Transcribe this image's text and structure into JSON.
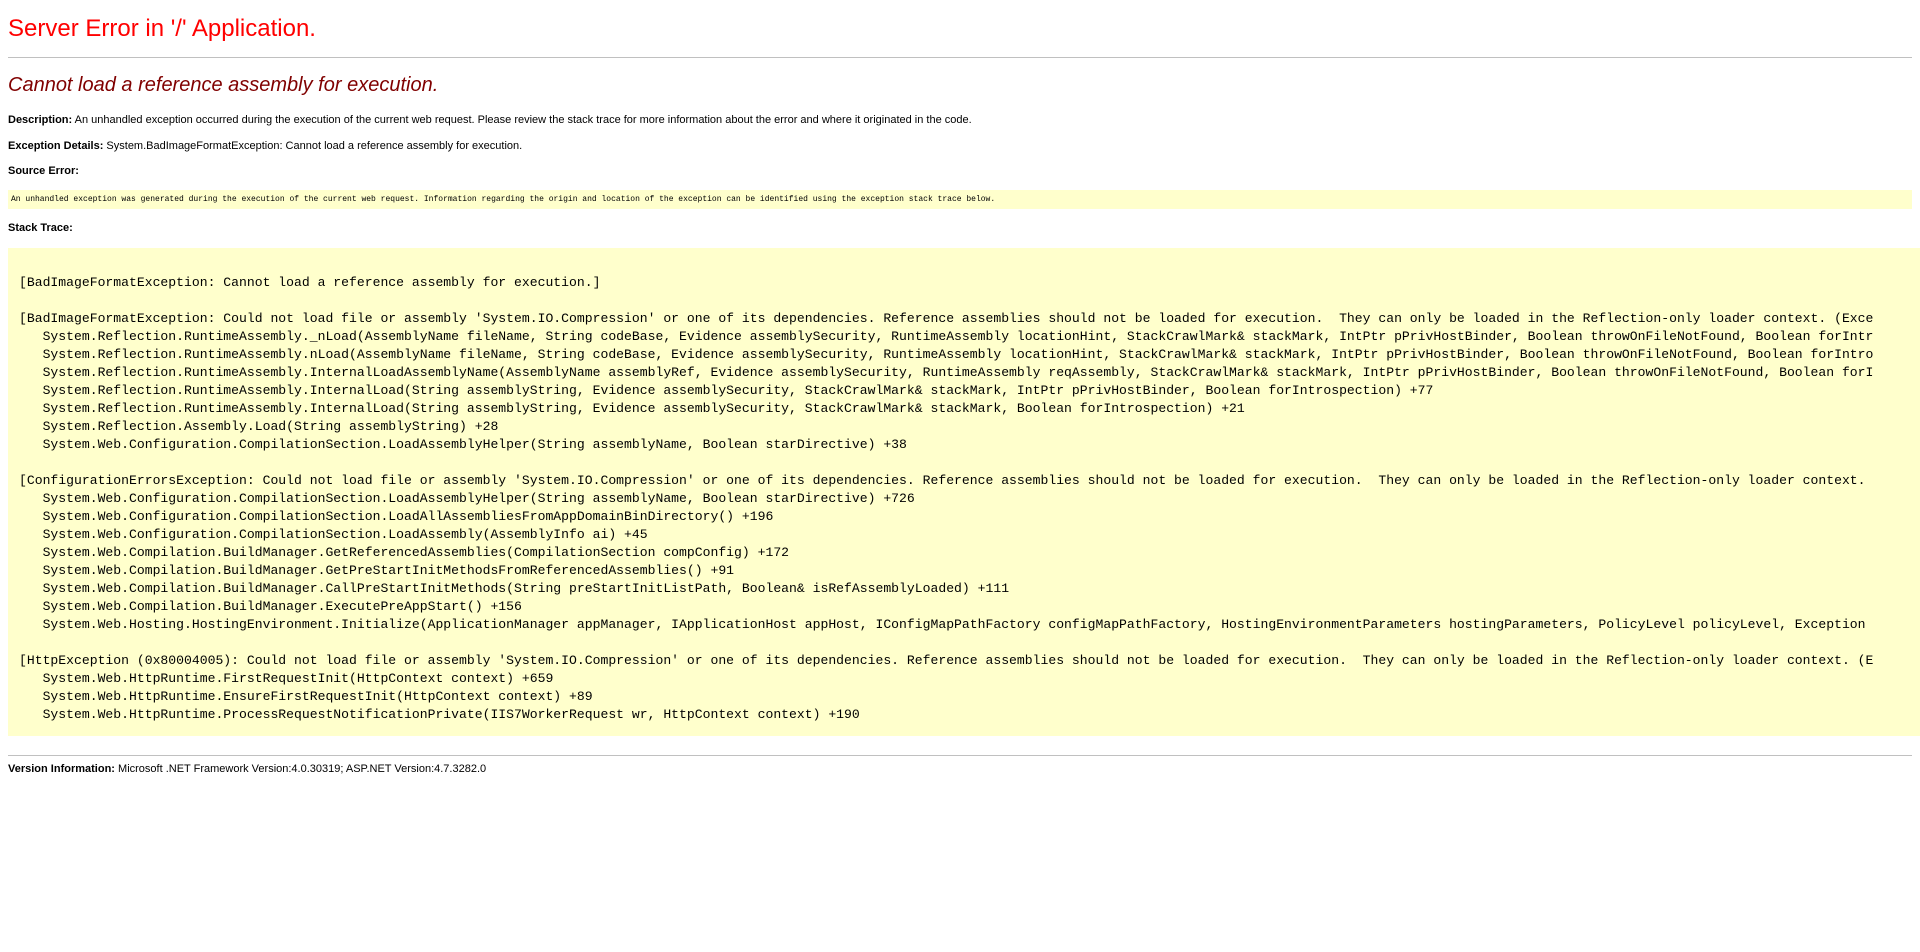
{
  "header": {
    "title": "Server Error in '/' Application."
  },
  "error": {
    "message": "Cannot load a reference assembly for execution."
  },
  "description": {
    "label": "Description:",
    "text": "An unhandled exception occurred during the execution of the current web request. Please review the stack trace for more information about the error and where it originated in the code."
  },
  "exception_details": {
    "label": "Exception Details:",
    "text": "System.BadImageFormatException: Cannot load a reference assembly for execution."
  },
  "source_error": {
    "label": "Source Error:",
    "text": "An unhandled exception was generated during the execution of the current web request. Information regarding the origin and location of the exception can be identified using the exception stack trace below."
  },
  "stack_trace": {
    "label": "Stack Trace:",
    "lines": [
      "",
      "[BadImageFormatException: Cannot load a reference assembly for execution.]",
      "",
      "[BadImageFormatException: Could not load file or assembly 'System.IO.Compression' or one of its dependencies. Reference assemblies should not be loaded for execution.  They can only be loaded in the Reflection-only loader context. (Exce",
      "   System.Reflection.RuntimeAssembly._nLoad(AssemblyName fileName, String codeBase, Evidence assemblySecurity, RuntimeAssembly locationHint, StackCrawlMark& stackMark, IntPtr pPrivHostBinder, Boolean throwOnFileNotFound, Boolean forIntr",
      "   System.Reflection.RuntimeAssembly.nLoad(AssemblyName fileName, String codeBase, Evidence assemblySecurity, RuntimeAssembly locationHint, StackCrawlMark& stackMark, IntPtr pPrivHostBinder, Boolean throwOnFileNotFound, Boolean forIntro",
      "   System.Reflection.RuntimeAssembly.InternalLoadAssemblyName(AssemblyName assemblyRef, Evidence assemblySecurity, RuntimeAssembly reqAssembly, StackCrawlMark& stackMark, IntPtr pPrivHostBinder, Boolean throwOnFileNotFound, Boolean forI",
      "   System.Reflection.RuntimeAssembly.InternalLoad(String assemblyString, Evidence assemblySecurity, StackCrawlMark& stackMark, IntPtr pPrivHostBinder, Boolean forIntrospection) +77",
      "   System.Reflection.RuntimeAssembly.InternalLoad(String assemblyString, Evidence assemblySecurity, StackCrawlMark& stackMark, Boolean forIntrospection) +21",
      "   System.Reflection.Assembly.Load(String assemblyString) +28",
      "   System.Web.Configuration.CompilationSection.LoadAssemblyHelper(String assemblyName, Boolean starDirective) +38",
      "",
      "[ConfigurationErrorsException: Could not load file or assembly 'System.IO.Compression' or one of its dependencies. Reference assemblies should not be loaded for execution.  They can only be loaded in the Reflection-only loader context.",
      "   System.Web.Configuration.CompilationSection.LoadAssemblyHelper(String assemblyName, Boolean starDirective) +726",
      "   System.Web.Configuration.CompilationSection.LoadAllAssembliesFromAppDomainBinDirectory() +196",
      "   System.Web.Configuration.CompilationSection.LoadAssembly(AssemblyInfo ai) +45",
      "   System.Web.Compilation.BuildManager.GetReferencedAssemblies(CompilationSection compConfig) +172",
      "   System.Web.Compilation.BuildManager.GetPreStartInitMethodsFromReferencedAssemblies() +91",
      "   System.Web.Compilation.BuildManager.CallPreStartInitMethods(String preStartInitListPath, Boolean& isRefAssemblyLoaded) +111",
      "   System.Web.Compilation.BuildManager.ExecutePreAppStart() +156",
      "   System.Web.Hosting.HostingEnvironment.Initialize(ApplicationManager appManager, IApplicationHost appHost, IConfigMapPathFactory configMapPathFactory, HostingEnvironmentParameters hostingParameters, PolicyLevel policyLevel, Exception",
      "",
      "[HttpException (0x80004005): Could not load file or assembly 'System.IO.Compression' or one of its dependencies. Reference assemblies should not be loaded for execution.  They can only be loaded in the Reflection-only loader context. (E",
      "   System.Web.HttpRuntime.FirstRequestInit(HttpContext context) +659",
      "   System.Web.HttpRuntime.EnsureFirstRequestInit(HttpContext context) +89",
      "   System.Web.HttpRuntime.ProcessRequestNotificationPrivate(IIS7WorkerRequest wr, HttpContext context) +190"
    ]
  },
  "version_information": {
    "label": "Version Information:",
    "text": "Microsoft .NET Framework Version:4.0.30319; ASP.NET Version:4.7.3282.0"
  },
  "colors": {
    "title": "#ff0000",
    "message": "#800000",
    "code_background": "#ffffcc",
    "rule": "#c0c0c0"
  }
}
